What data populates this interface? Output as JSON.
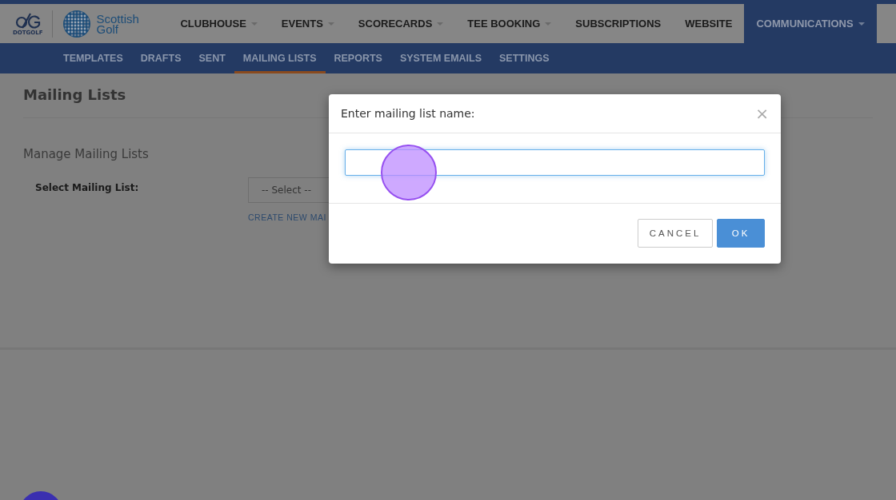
{
  "header": {
    "brand": "DOTGOLF",
    "partner": "Scottish Golf",
    "nav": [
      {
        "label": "CLUBHOUSE",
        "dropdown": true,
        "selected": false
      },
      {
        "label": "EVENTS",
        "dropdown": true,
        "selected": false
      },
      {
        "label": "SCORECARDS",
        "dropdown": true,
        "selected": false
      },
      {
        "label": "TEE BOOKING",
        "dropdown": true,
        "selected": false
      },
      {
        "label": "SUBSCRIPTIONS",
        "dropdown": false,
        "selected": false
      },
      {
        "label": "WEBSITE",
        "dropdown": false,
        "selected": false
      },
      {
        "label": "COMMUNICATIONS",
        "dropdown": true,
        "selected": true
      }
    ]
  },
  "subnav": [
    {
      "label": "TEMPLATES",
      "selected": false
    },
    {
      "label": "DRAFTS",
      "selected": false
    },
    {
      "label": "SENT",
      "selected": false
    },
    {
      "label": "MAILING LISTS",
      "selected": true
    },
    {
      "label": "REPORTS",
      "selected": false
    },
    {
      "label": "SYSTEM EMAILS",
      "selected": false
    },
    {
      "label": "SETTINGS",
      "selected": false
    }
  ],
  "page": {
    "title": "Mailing Lists",
    "section": "Manage Mailing Lists",
    "select_label": "Select Mailing List:",
    "select": {
      "value": "-- Select --"
    },
    "create_link": "CREATE NEW MAI"
  },
  "dialog": {
    "title": "Enter mailing list name:",
    "close": "×",
    "input": {
      "focused": true
    },
    "buttons": [
      {
        "label": "CANCEL",
        "kind": "secondary"
      },
      {
        "label": "OK",
        "kind": "primary"
      }
    ]
  }
}
